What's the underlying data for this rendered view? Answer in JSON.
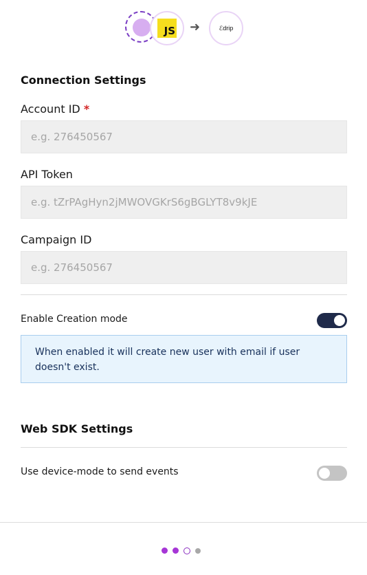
{
  "header": {
    "source_icon": "js-logo-icon",
    "source_logo_text": "JS",
    "arrow_icon": "arrow-right-icon",
    "arrow_glyph": "➜",
    "destination_logo_text": "ℰdrip"
  },
  "connection": {
    "title": "Connection Settings",
    "account_id": {
      "label": "Account ID",
      "required_mark": "*",
      "placeholder": "e.g. 276450567",
      "value": ""
    },
    "api_token": {
      "label": "API Token",
      "placeholder": "e.g. tZrPAgHyn2jMWOVGKrS6gBGLYT8v9kJE",
      "value": ""
    },
    "campaign_id": {
      "label": "Campaign ID",
      "placeholder": "e.g. 276450567",
      "value": ""
    },
    "creation_mode": {
      "label": "Enable Creation mode",
      "enabled": true
    },
    "info_text": "When enabled it will create new user with email if user doesn't exist."
  },
  "web_sdk": {
    "title": "Web SDK Settings",
    "device_mode": {
      "label": "Use device-mode to send events",
      "enabled": false
    }
  },
  "steps": {
    "total": 4,
    "current": 3,
    "colors": {
      "done": "#a636d6",
      "current": "#8a2fc0",
      "pending": "#a8a8a8"
    }
  },
  "colors": {
    "toggle_on": "#1f2a4a",
    "toggle_off": "#c4c4c4",
    "required": "#d32424",
    "info_bg": "#e8f4fd",
    "info_border": "#a8cdee"
  }
}
